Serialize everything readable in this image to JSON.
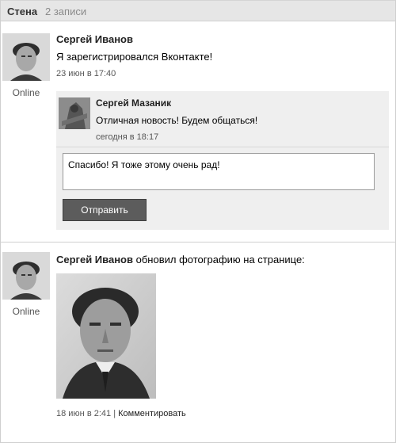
{
  "header": {
    "title": "Стена",
    "count": "2 записи"
  },
  "post1": {
    "author": "Сергей Иванов",
    "status": "Online",
    "text": "Я зарегистрировался Вконтакте!",
    "date": "23 июн в 17:40",
    "comment": {
      "author": "Сергей Мазаник",
      "text": "Отличная новость! Будем общаться!",
      "date": "сегодня в 18:17"
    },
    "reply": {
      "text": "Спасибо! Я тоже этому очень рад!",
      "send_label": "Отправить"
    }
  },
  "post2": {
    "author": "Сергей Иванов",
    "action": "обновил фотографию на странице:",
    "status": "Online",
    "date": "18 июн в 2:41",
    "separator": "|",
    "comment_link": "Комментировать"
  }
}
